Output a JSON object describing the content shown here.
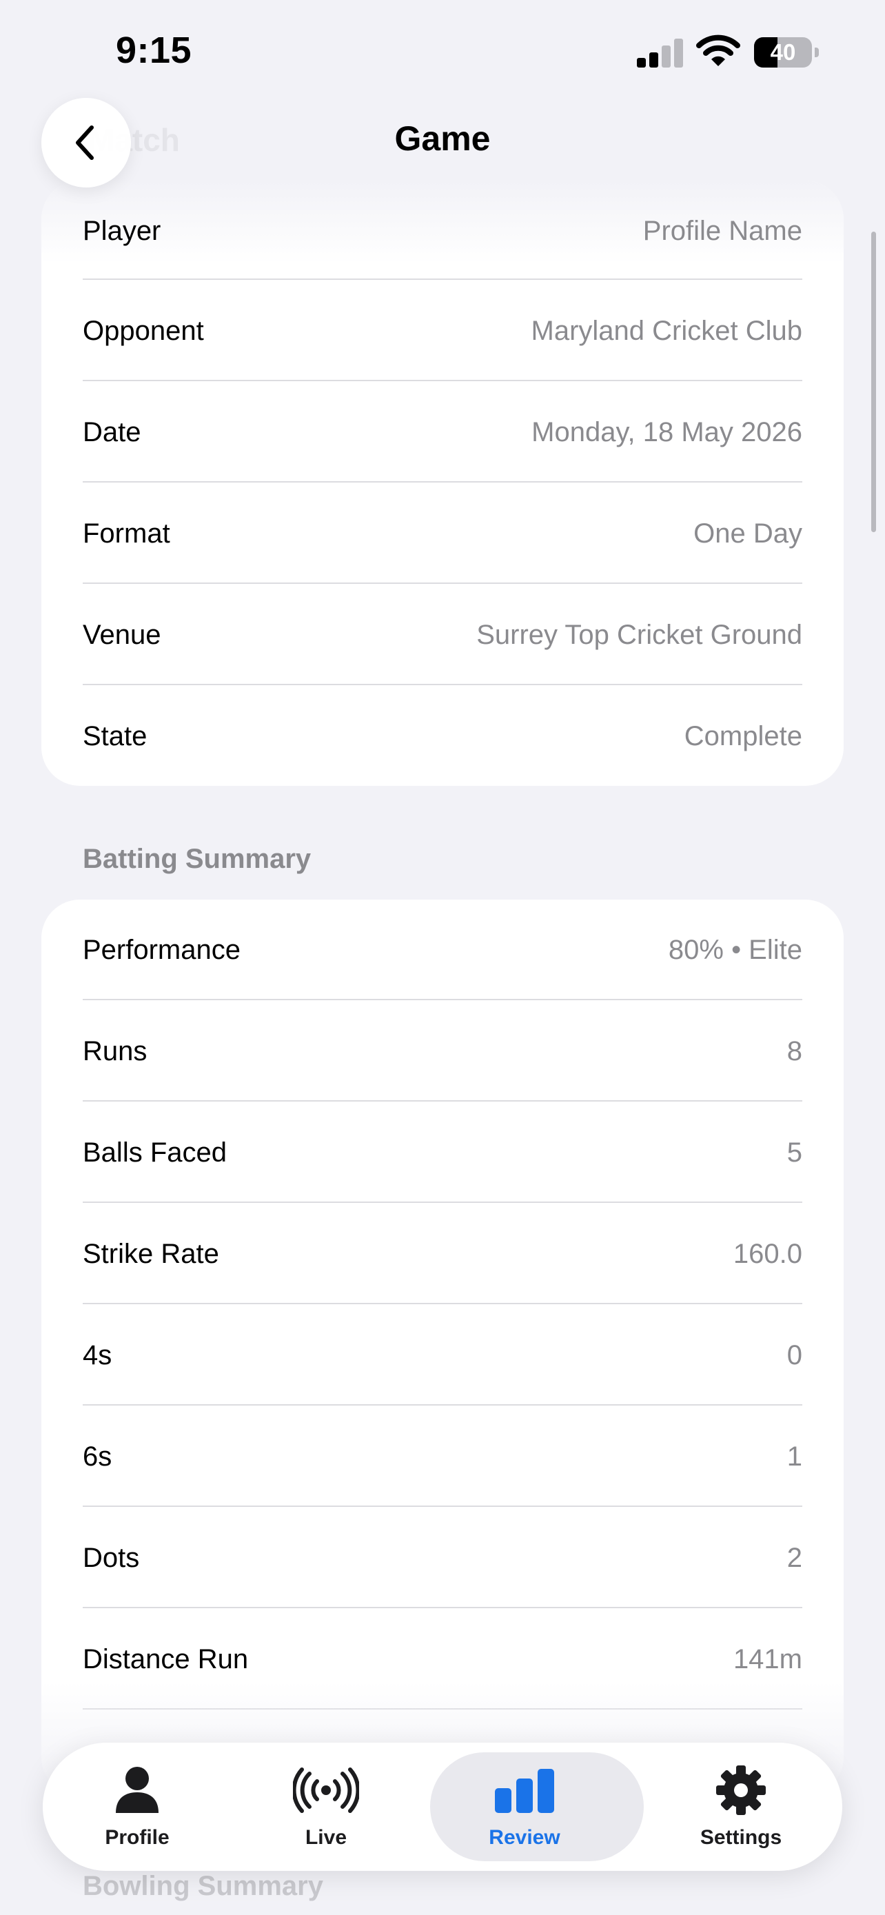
{
  "status_bar": {
    "time": "9:15",
    "battery_level": "40",
    "battery_fraction": 0.4,
    "signal_bars_active": 2,
    "signal_bars_total": 4
  },
  "nav": {
    "title": "Game",
    "back_icon": "chevron-left-icon"
  },
  "match_info": {
    "rows": [
      {
        "label": "Player",
        "value": "Profile Name"
      },
      {
        "label": "Opponent",
        "value": "Maryland Cricket Club"
      },
      {
        "label": "Date",
        "value": "Monday, 18 May 2026"
      },
      {
        "label": "Format",
        "value": "One Day"
      },
      {
        "label": "Venue",
        "value": "Surrey Top Cricket Ground"
      },
      {
        "label": "State",
        "value": "Complete"
      }
    ]
  },
  "batting_summary": {
    "header": "Batting Summary",
    "rows": [
      {
        "label": "Performance",
        "value": "80% • Elite"
      },
      {
        "label": "Runs",
        "value": "8"
      },
      {
        "label": "Balls Faced",
        "value": "5"
      },
      {
        "label": "Strike Rate",
        "value": "160.0"
      },
      {
        "label": "4s",
        "value": "0"
      },
      {
        "label": "6s",
        "value": "1"
      },
      {
        "label": "Dots",
        "value": "2"
      },
      {
        "label": "Distance Run",
        "value": "141m"
      }
    ]
  },
  "bowling_summary": {
    "header": "Bowling Summary"
  },
  "tab_bar": {
    "tabs": [
      {
        "label": "Profile",
        "icon": "person-icon",
        "selected": false
      },
      {
        "label": "Live",
        "icon": "broadcast-icon",
        "selected": false
      },
      {
        "label": "Review",
        "icon": "bar-chart-icon",
        "selected": true
      },
      {
        "label": "Settings",
        "icon": "gear-icon",
        "selected": false
      }
    ]
  },
  "colors": {
    "accent": "#1a73e8",
    "background": "#f2f2f7",
    "card": "#ffffff",
    "secondary_text": "#8a8a8e"
  }
}
